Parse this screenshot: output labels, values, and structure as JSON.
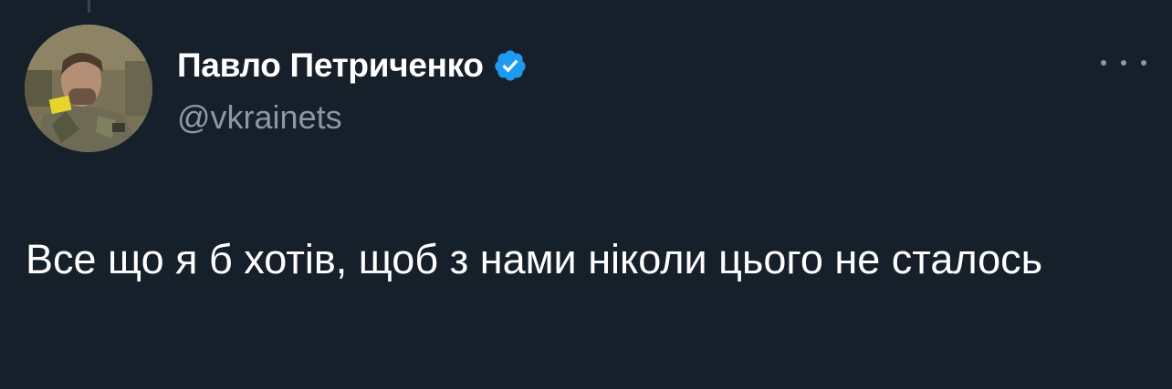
{
  "tweet": {
    "author": {
      "display_name": "Павло Петриченко",
      "handle": "@vkrainets",
      "verified": true
    },
    "text": "Все що я б хотів, щоб з нами ніколи цього не сталось"
  },
  "icons": {
    "verified": "verified-badge-icon",
    "more": "more-options-icon"
  },
  "colors": {
    "background": "#15202b",
    "text_primary": "#ffffff",
    "text_secondary": "#8b98a5",
    "verified_blue": "#1d9bf0",
    "thread_line": "#38444d"
  }
}
